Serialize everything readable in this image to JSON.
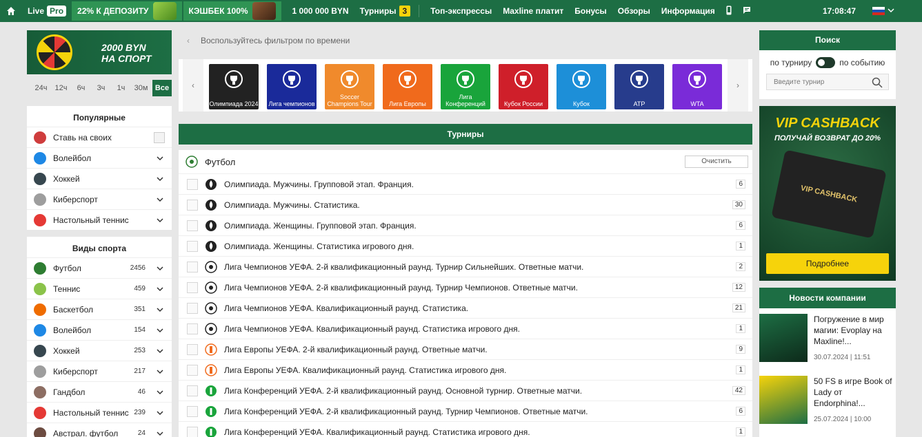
{
  "topbar": {
    "live": "Live",
    "pro": "Pro",
    "promo1": "22% К ДЕПОЗИТУ",
    "promo2": "КЭШБЕК 100%",
    "jackpot": "1 000 000 BYN",
    "tournaments": "Турниры",
    "tournaments_count": "3",
    "top_express": "Топ-экспрессы",
    "maxline_pays": "Maxline платит",
    "bonuses": "Бонусы",
    "reviews": "Обзоры",
    "info": "Информация",
    "time": "17:08:47"
  },
  "left": {
    "banner": "2000 BYN НА СПОРТ",
    "banner_l1": "2000 BYN",
    "banner_l2": "НА СПОРТ",
    "hours": [
      "24ч",
      "12ч",
      "6ч",
      "3ч",
      "1ч",
      "30м"
    ],
    "hours_all": "Все",
    "popular_title": "Популярные",
    "popular": [
      {
        "label": "Ставь на своих",
        "color": "#cf3d3d"
      },
      {
        "label": "Волейбол",
        "color": "#1e88e5"
      },
      {
        "label": "Хоккей",
        "color": "#37474f"
      },
      {
        "label": "Киберспорт",
        "color": "#9e9e9e"
      },
      {
        "label": "Настольный теннис",
        "color": "#e53935"
      }
    ],
    "sports_title": "Виды спорта",
    "sports": [
      {
        "label": "Футбол",
        "count": "2456",
        "color": "#2e7d32"
      },
      {
        "label": "Теннис",
        "count": "459",
        "color": "#8bc34a"
      },
      {
        "label": "Баскетбол",
        "count": "351",
        "color": "#ef6c00"
      },
      {
        "label": "Волейбол",
        "count": "154",
        "color": "#1e88e5"
      },
      {
        "label": "Хоккей",
        "count": "253",
        "color": "#37474f"
      },
      {
        "label": "Киберспорт",
        "count": "217",
        "color": "#9e9e9e"
      },
      {
        "label": "Гандбол",
        "count": "46",
        "color": "#8d6e63"
      },
      {
        "label": "Настольный теннис",
        "count": "239",
        "color": "#e53935"
      },
      {
        "label": "Австрал. футбол",
        "count": "24",
        "color": "#6d4c41"
      }
    ]
  },
  "main": {
    "filter_hint": "Воспользуйтесь фильтром по времени",
    "tiles": [
      {
        "label": "Олимпиада 2024",
        "color": "#222222"
      },
      {
        "label": "Лига чемпионов",
        "color": "#1a2a9a"
      },
      {
        "label": "Soccer Champions Tour",
        "color": "#f08a2c"
      },
      {
        "label": "Лига Европы",
        "color": "#f06a1c"
      },
      {
        "label": "Лига Конференций",
        "color": "#19a43b"
      },
      {
        "label": "Кубок России",
        "color": "#cf1f2a"
      },
      {
        "label": "Кубок",
        "color": "#1d8fd8"
      },
      {
        "label": "ATP",
        "color": "#273c8c"
      },
      {
        "label": "WTA",
        "color": "#7a2bd8"
      }
    ],
    "tournaments_title": "Турниры",
    "sport": "Футбол",
    "clear": "Очистить",
    "rows": [
      {
        "name": "Олимпиада. Мужчины. Групповой этап. Франция.",
        "count": "6",
        "type": "olymp"
      },
      {
        "name": "Олимпиада. Мужчины. Статистика.",
        "count": "30",
        "type": "olymp"
      },
      {
        "name": "Олимпиада. Женщины. Групповой этап. Франция.",
        "count": "6",
        "type": "olymp"
      },
      {
        "name": "Олимпиада. Женщины. Статистика игрового дня.",
        "count": "1",
        "type": "olymp"
      },
      {
        "name": "Лига Чемпионов УЕФА. 2-й квалификационный раунд. Турнир Сильнейших. Ответные матчи.",
        "count": "2",
        "type": "ucl"
      },
      {
        "name": "Лига Чемпионов УЕФА. 2-й квалификационный раунд. Турнир Чемпионов. Ответные матчи.",
        "count": "12",
        "type": "ucl"
      },
      {
        "name": "Лига Чемпионов УЕФА. Квалификационный раунд. Статистика.",
        "count": "21",
        "type": "ucl"
      },
      {
        "name": "Лига Чемпионов УЕФА. Квалификационный раунд. Статистика игрового дня.",
        "count": "1",
        "type": "ucl"
      },
      {
        "name": "Лига Европы УЕФА. 2-й квалификационный раунд. Ответные матчи.",
        "count": "9",
        "type": "uel"
      },
      {
        "name": "Лига Европы УЕФА. Квалификационный раунд. Статистика игрового дня.",
        "count": "1",
        "type": "uel"
      },
      {
        "name": "Лига Конференций УЕФА. 2-й квалификационный раунд. Основной турнир. Ответные матчи.",
        "count": "42",
        "type": "uecl"
      },
      {
        "name": "Лига Конференций УЕФА. 2-й квалификационный раунд. Турнир Чемпионов. Ответные матчи.",
        "count": "6",
        "type": "uecl"
      },
      {
        "name": "Лига Конференций УЕФА. Квалификационный раунд. Статистика игрового дня.",
        "count": "1",
        "type": "uecl"
      }
    ]
  },
  "right": {
    "search_title": "Поиск",
    "by_tournament": "по турниру",
    "by_event": "по событию",
    "search_placeholder": "Введите турнир",
    "vip_title": "VIP CASHBACK",
    "vip_sub": "ПОЛУЧАЙ ВОЗВРАТ ДО 20%",
    "vip_card": "VIP CASHBACK",
    "vip_more": "Подробнее",
    "news_title": "Новости компании",
    "news": [
      {
        "title": "Погружение в мир магии: Evoplay на Maxline!...",
        "date": "30.07.2024 | 11:51"
      },
      {
        "title": "50 FS в игре Book of Lady от Endorphina!...",
        "date": "25.07.2024 | 10:00"
      }
    ]
  },
  "colors": {
    "brand": "#1d6e44",
    "accent": "#f6d30b"
  }
}
